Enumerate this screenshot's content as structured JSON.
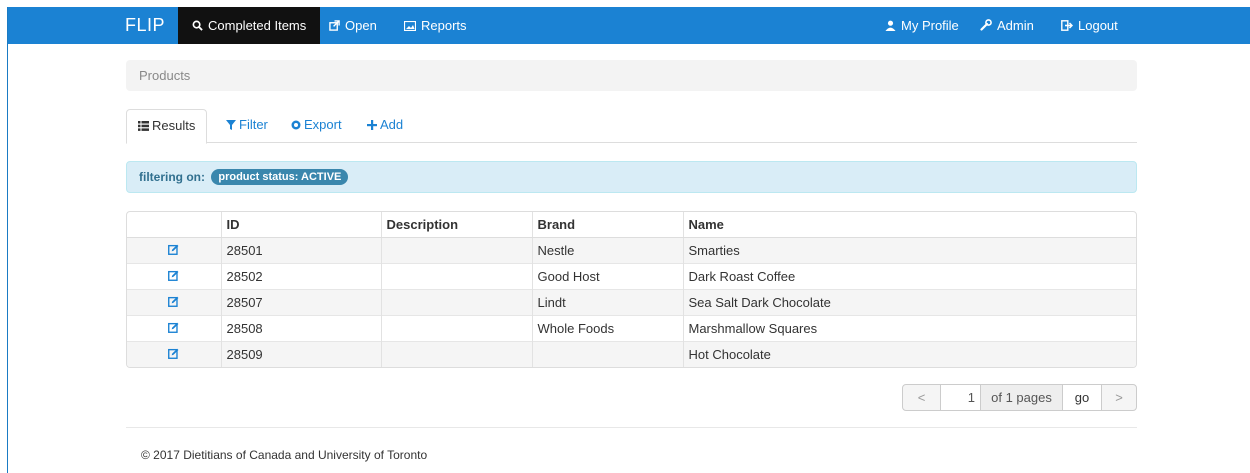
{
  "navbar": {
    "brand": "FLIP",
    "left_items": [
      {
        "label": "Completed Items",
        "icon": "search-icon",
        "active": true
      },
      {
        "label": "Open",
        "icon": "external-link-icon"
      },
      {
        "label": "Reports",
        "icon": "image-icon"
      }
    ],
    "right_items": [
      {
        "label": "My Profile",
        "icon": "user-icon"
      },
      {
        "label": "Admin",
        "icon": "wrench-icon"
      },
      {
        "label": "Logout",
        "icon": "logout-icon"
      }
    ]
  },
  "breadcrumb": "Products",
  "tabs": [
    {
      "label": "Results",
      "icon": "list-icon",
      "active": true
    },
    {
      "label": "Filter",
      "icon": "filter-icon"
    },
    {
      "label": "Export",
      "icon": "export-icon"
    },
    {
      "label": "Add",
      "icon": "plus-icon"
    }
  ],
  "filter": {
    "label": "filtering on:",
    "badge": "product status: ACTIVE"
  },
  "table": {
    "columns": [
      "",
      "ID",
      "Description",
      "Brand",
      "Name"
    ],
    "rows": [
      {
        "id": "28501",
        "description": "",
        "brand": "Nestle",
        "name": "Smarties"
      },
      {
        "id": "28502",
        "description": "",
        "brand": "Good Host",
        "name": "Dark Roast Coffee"
      },
      {
        "id": "28507",
        "description": "",
        "brand": "Lindt",
        "name": "Sea Salt Dark Chocolate"
      },
      {
        "id": "28508",
        "description": "",
        "brand": "Whole Foods",
        "name": "Marshmallow Squares"
      },
      {
        "id": "28509",
        "description": "",
        "brand": "",
        "name": "Hot Chocolate"
      }
    ]
  },
  "pagination": {
    "prev": "<",
    "page": "1",
    "of_pages": "of 1 pages",
    "go": "go",
    "next": ">"
  },
  "footer": "© 2017 Dietitians of Canada and University of Toronto",
  "colors": {
    "navbar": "#1b82d3",
    "active_nav": "#111111",
    "link": "#1b82d3",
    "alert_bg": "#d9edf7",
    "badge": "#3a87ad"
  }
}
